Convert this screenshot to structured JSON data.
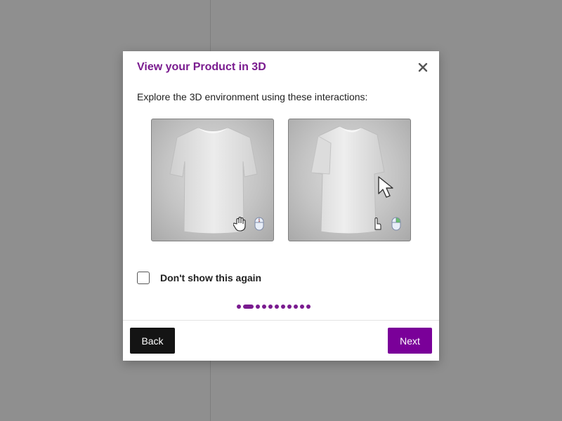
{
  "modal": {
    "title": "View your Product in 3D",
    "intro": "Explore the 3D environment using these interactions:",
    "close_icon": "close-icon",
    "checkbox_label": "Don't show this again",
    "checkbox_checked": false,
    "pager": {
      "total": 11,
      "active_index": 1
    },
    "back_label": "Back",
    "next_label": "Next",
    "thumbnails": [
      {
        "name": "tshirt-front",
        "icons": [
          "hand-grab-icon",
          "mouse-left-click-icon"
        ]
      },
      {
        "name": "tshirt-side",
        "icons": [
          "cursor-arrow-icon",
          "mouse-right-click-icon"
        ]
      }
    ]
  },
  "colors": {
    "accent": "#7a0099",
    "title": "#7a1b8f",
    "back_button": "#141414",
    "overlay": "#8f8f8f"
  }
}
